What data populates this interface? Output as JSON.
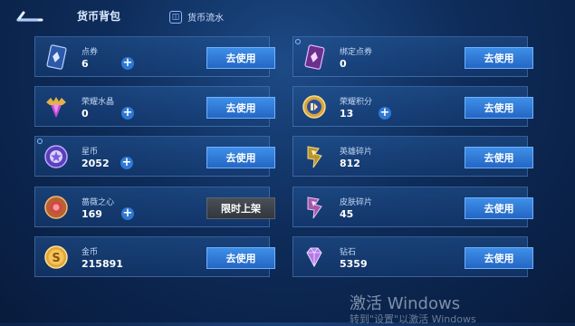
{
  "header": {
    "title": "货币背包",
    "flow_label": "货币流水",
    "flow_icon_glyph": "◫"
  },
  "currencies": [
    {
      "label": "点券",
      "value": "6",
      "button": "去使用",
      "has_plus": true,
      "icon": "coupon-card-icon"
    },
    {
      "label": "绑定点券",
      "value": "0",
      "button": "去使用",
      "has_plus": false,
      "icon": "bound-coupon-card-icon"
    },
    {
      "label": "荣耀水晶",
      "value": "0",
      "button": "去使用",
      "has_plus": true,
      "icon": "glory-crystal-icon"
    },
    {
      "label": "荣耀积分",
      "value": "13",
      "button": "去使用",
      "has_plus": true,
      "icon": "glory-points-icon"
    },
    {
      "label": "星币",
      "value": "2052",
      "button": "去使用",
      "has_plus": true,
      "icon": "star-coin-icon"
    },
    {
      "label": "英雄碎片",
      "value": "812",
      "button": "去使用",
      "has_plus": false,
      "icon": "hero-fragment-icon"
    },
    {
      "label": "蔷薇之心",
      "value": "169",
      "button": "限时上架",
      "has_plus": true,
      "icon": "rose-heart-icon"
    },
    {
      "label": "皮肤碎片",
      "value": "45",
      "button": "去使用",
      "has_plus": false,
      "icon": "skin-fragment-icon"
    },
    {
      "label": "金币",
      "value": "215891",
      "button": "去使用",
      "has_plus": false,
      "icon": "gold-coin-icon"
    },
    {
      "label": "钻石",
      "value": "5359",
      "button": "去使用",
      "has_plus": false,
      "icon": "diamond-icon"
    }
  ],
  "watermark": {
    "line1": "激活 Windows",
    "line2": "转到\"设置\"以激活 Windows"
  },
  "colors": {
    "accent_button": "#2f78d4",
    "disabled_button": "#3a3f47",
    "background": "#0e2c5a"
  }
}
